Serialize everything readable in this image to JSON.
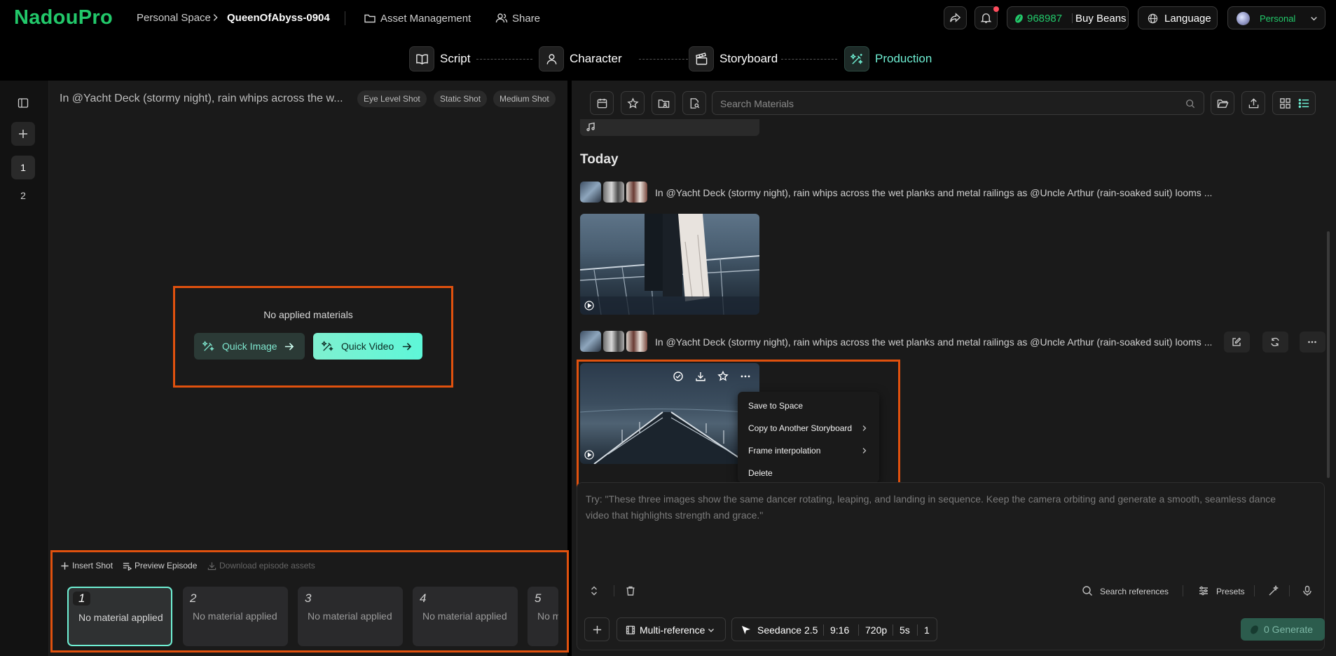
{
  "app": {
    "logo": "NadouPro"
  },
  "breadcrumb": {
    "space": "Personal Space",
    "project": "QueenOfAbyss-0904"
  },
  "header": {
    "asset_management": "Asset Management",
    "share": "Share",
    "beans_count": "968987",
    "buy_beans": "Buy Beans",
    "language": "Language",
    "account": "Personal",
    "notification_badge_color": "#ff4d5e"
  },
  "steps": [
    {
      "label": "Script",
      "icon": "book-icon"
    },
    {
      "label": "Character",
      "icon": "user-icon"
    },
    {
      "label": "Storyboard",
      "icon": "clapperboard-icon"
    },
    {
      "label": "Production",
      "icon": "wand-icon",
      "active": true
    }
  ],
  "sidebar": {
    "episodes": [
      "1",
      "2"
    ],
    "active_episode": "1"
  },
  "shot": {
    "description": "In @Yacht Deck (stormy night), rain whips across the w...",
    "tags": [
      "Eye Level Shot",
      "Static Shot",
      "Medium Shot"
    ]
  },
  "empty_state": {
    "message": "No applied materials",
    "quick_image": "Quick Image",
    "quick_video": "Quick Video"
  },
  "shot_actions": {
    "insert": "Insert Shot",
    "preview": "Preview Episode",
    "download": "Download episode assets"
  },
  "shots": [
    {
      "number": "1",
      "status": "No material applied",
      "selected": true
    },
    {
      "number": "2",
      "status": "No material applied"
    },
    {
      "number": "3",
      "status": "No material applied"
    },
    {
      "number": "4",
      "status": "No material applied"
    },
    {
      "number": "5",
      "status": "No material applied"
    }
  ],
  "materials": {
    "search_placeholder": "Search Materials",
    "section_title": "Today",
    "rows": [
      {
        "prompt": "In @Yacht Deck (stormy night), rain whips across the wet planks and metal railings as @Uncle Arthur (rain-soaked suit) looms ..."
      },
      {
        "prompt": "In @Yacht Deck (stormy night), rain whips across the wet planks and metal railings as @Uncle Arthur (rain-soaked suit) looms ..."
      }
    ]
  },
  "context_menu": {
    "items": [
      "Save to Space",
      "Copy to Another Storyboard",
      "Frame interpolation",
      "Delete"
    ]
  },
  "composer": {
    "prompt_placeholder": "Try: \"These three images show the same dancer rotating, leaping, and landing in sequence. Keep the camera orbiting and generate a smooth, seamless dance video that highlights strength and grace.\"",
    "search_references": "Search references",
    "presets": "Presets",
    "mode": "Multi-reference",
    "model": "Seedance 2.5",
    "aspect": "9:16",
    "resolution": "720p",
    "duration": "5s",
    "count": "1",
    "generate": "0 Generate"
  },
  "colors": {
    "brand": "#22c86a",
    "accent": "#6ff0d4",
    "highlight": "#e0510e"
  }
}
